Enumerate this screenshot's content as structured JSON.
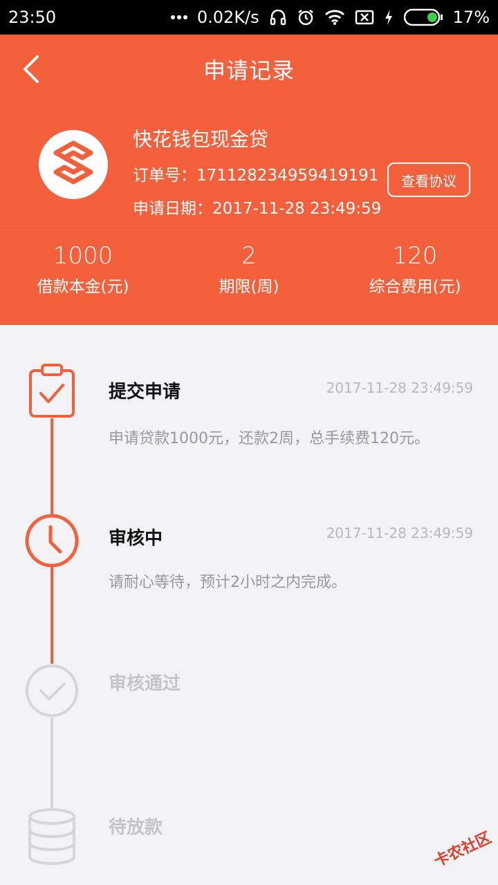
{
  "status_bar": {
    "time": "23:50",
    "network_speed": "0.02K/s",
    "battery": "17%",
    "icons": [
      "more-dots-icon",
      "headset-icon",
      "alarm-icon",
      "wifi-icon",
      "no-sim-icon",
      "charging-icon",
      "battery-icon"
    ]
  },
  "header": {
    "title": "申请记录",
    "back_icon": "chevron-left-icon"
  },
  "product": {
    "name": "快花钱包现金贷",
    "order_line": "订单号：171128234959419191",
    "date_line": "申请日期：2017-11-28 23:49:59",
    "contract_button": "查看协议"
  },
  "stats": [
    {
      "value": "1000",
      "label": "借款本金(元)"
    },
    {
      "value": "2",
      "label": "期限(周)"
    },
    {
      "value": "120",
      "label": "综合费用(元)"
    }
  ],
  "steps": [
    {
      "title": "提交申请",
      "time": "2017-11-28 23:49:59",
      "desc": "申请贷款1000元，还款2周，总手续费120元。",
      "icon": "clipboard-check-icon",
      "state": "done"
    },
    {
      "title": "审核中",
      "time": "2017-11-28 23:49:59",
      "desc": "请耐心等待，预计2小时之内完成。",
      "icon": "clock-icon",
      "state": "active"
    },
    {
      "title": "审核通过",
      "time": "",
      "desc": "",
      "icon": "check-circle-icon",
      "state": "pending"
    },
    {
      "title": "待放款",
      "time": "",
      "desc": "",
      "icon": "coin-stack-icon",
      "state": "pending"
    }
  ],
  "watermark": {
    "text": "卡农社区"
  },
  "colors": {
    "accent": "#f5603c",
    "inactive": "#d6d6d6",
    "background": "#f3f3f6"
  }
}
